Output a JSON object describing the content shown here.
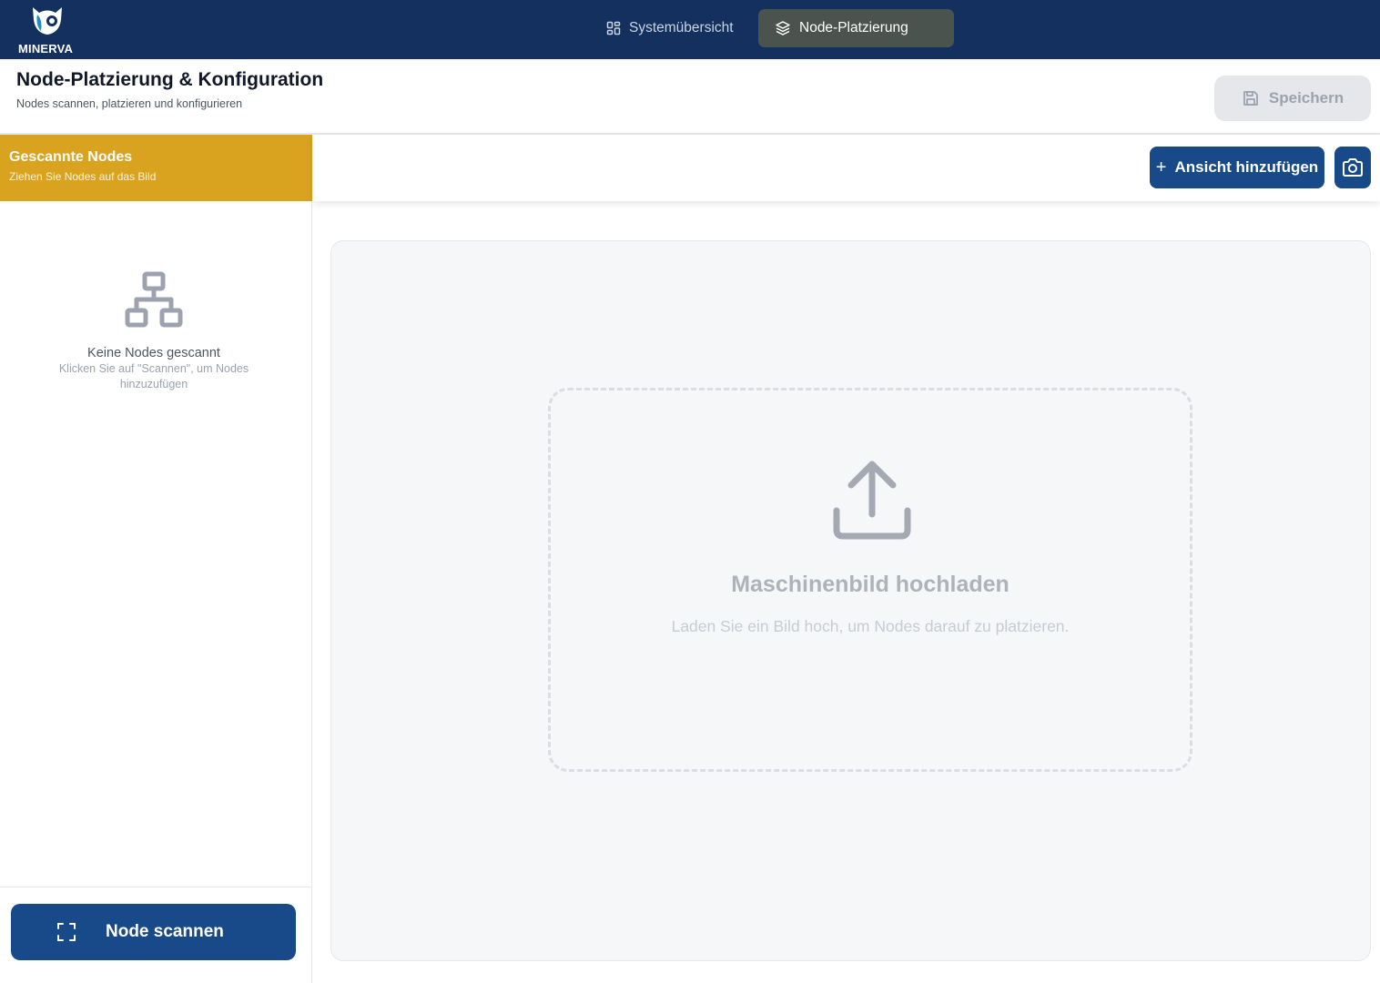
{
  "app": {
    "logo_text": "MINERVA",
    "colors": {
      "navbar": "#13305f",
      "accent_gold": "#d9a21f",
      "primary_button": "#184a8a"
    }
  },
  "nav": {
    "tabs": [
      {
        "label": "Systemübersicht",
        "icon": "grid-icon",
        "active": false
      },
      {
        "label": "Node-Platzierung",
        "icon": "layers-icon",
        "active": true
      }
    ]
  },
  "header": {
    "title": "Node-Platzierung & Konfiguration",
    "subtitle": "Nodes scannen, platzieren und konfigurieren",
    "save_label": "Speichern",
    "save_icon": "save-icon"
  },
  "sidebar": {
    "title": "Gescannte Nodes",
    "subtitle": "Ziehen Sie Nodes auf das Bild",
    "empty_icon": "network-icon",
    "empty_title": "Keine Nodes gescannt",
    "empty_subtitle": "Klicken Sie auf \"Scannen\", um Nodes hinzuzufügen",
    "scan_button_label": "Node scannen",
    "scan_icon": "scan-frame-icon"
  },
  "toolbar": {
    "add_view_label": "Ansicht hinzufügen",
    "add_view_icon": "plus-icon",
    "camera_icon": "camera-icon"
  },
  "canvas": {
    "upload_icon": "upload-icon",
    "upload_title": "Maschinenbild hochladen",
    "upload_subtitle": "Laden Sie ein Bild hoch, um Nodes darauf zu platzieren."
  }
}
